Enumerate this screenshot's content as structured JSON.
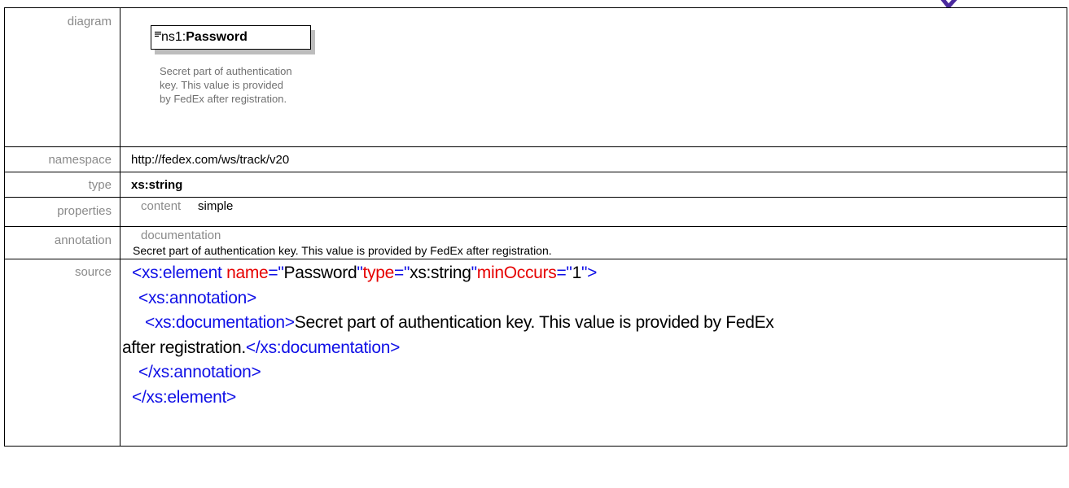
{
  "labels": {
    "diagram": "diagram",
    "namespace": "namespace",
    "type": "type",
    "properties": "properties",
    "annotation": "annotation",
    "source": "source"
  },
  "diagram": {
    "prefix": "ns1:",
    "element_name": "Password",
    "doc_line1": "Secret part of authentication",
    "doc_line2": "key. This value is provided",
    "doc_line3": "by FedEx after registration."
  },
  "namespace": "http://fedex.com/ws/track/v20",
  "type": "xs:string",
  "properties": {
    "key": "content",
    "value": "simple"
  },
  "annotation": {
    "heading": "documentation",
    "text": "Secret part of authentication key. This value is provided by FedEx after registration."
  },
  "source": {
    "l1_open": "<xs:element",
    "l1_attr1": "name",
    "l1_eq1": "=\"",
    "l1_val1": "Password",
    "l1_q1": "\"",
    "l1_attr2": "type",
    "l1_eq2": "=\"",
    "l1_val2": "xs:string",
    "l1_q2": "\"",
    "l1_attr3": "minOccurs",
    "l1_eq3": "=\"",
    "l1_val3": "1",
    "l1_close": "\">",
    "l2": "<xs:annotation>",
    "l3_open": "<xs:documentation>",
    "l3_text": "Secret part of authentication key. This value is provided by FedEx",
    "l4_text": "after registration.",
    "l4_close": "</xs:documentation>",
    "l5": "</xs:annotation>",
    "l6": "</xs:element>"
  },
  "colors": {
    "tag": "#1010e6",
    "attribute": "#e60000",
    "label": "#8a8a8a",
    "accent": "#4b2a9e"
  }
}
